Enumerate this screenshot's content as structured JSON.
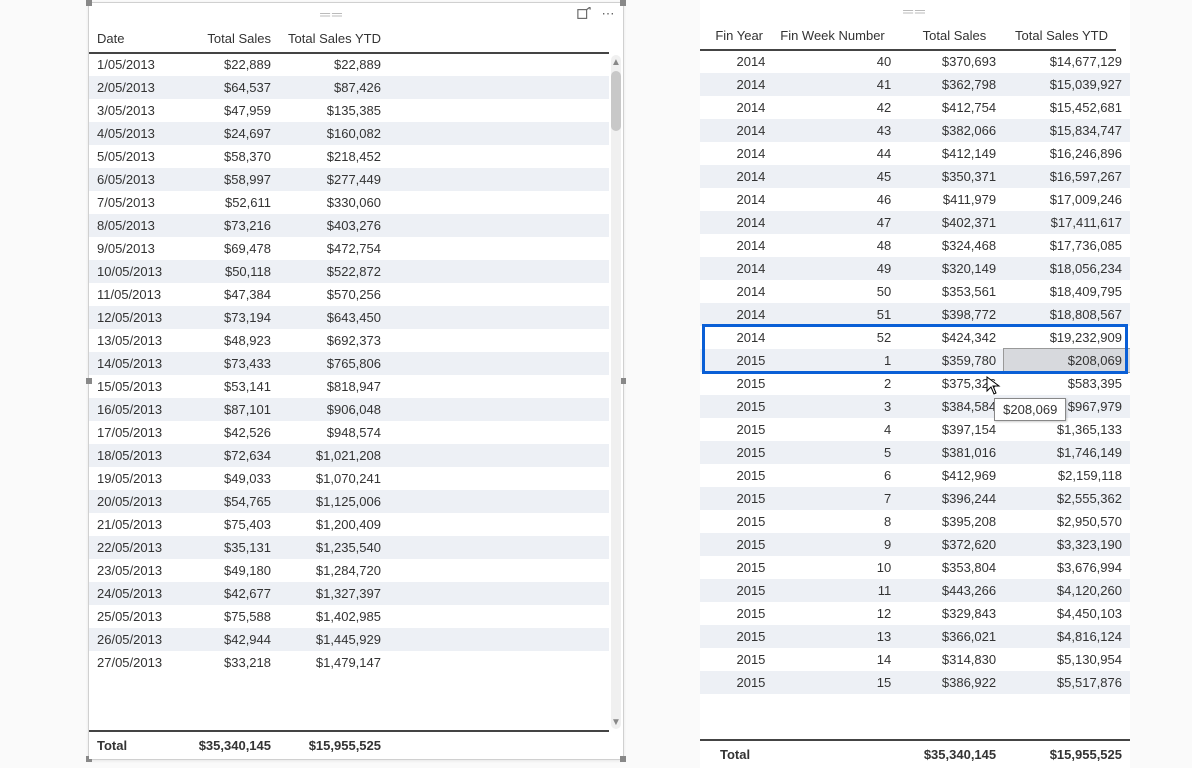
{
  "left_table": {
    "headers": [
      "Date",
      "Total Sales",
      "Total Sales YTD"
    ],
    "rows": [
      {
        "date": "1/05/2013",
        "sales": "$22,889",
        "ytd": "$22,889"
      },
      {
        "date": "2/05/2013",
        "sales": "$64,537",
        "ytd": "$87,426"
      },
      {
        "date": "3/05/2013",
        "sales": "$47,959",
        "ytd": "$135,385"
      },
      {
        "date": "4/05/2013",
        "sales": "$24,697",
        "ytd": "$160,082"
      },
      {
        "date": "5/05/2013",
        "sales": "$58,370",
        "ytd": "$218,452"
      },
      {
        "date": "6/05/2013",
        "sales": "$58,997",
        "ytd": "$277,449"
      },
      {
        "date": "7/05/2013",
        "sales": "$52,611",
        "ytd": "$330,060"
      },
      {
        "date": "8/05/2013",
        "sales": "$73,216",
        "ytd": "$403,276"
      },
      {
        "date": "9/05/2013",
        "sales": "$69,478",
        "ytd": "$472,754"
      },
      {
        "date": "10/05/2013",
        "sales": "$50,118",
        "ytd": "$522,872"
      },
      {
        "date": "11/05/2013",
        "sales": "$47,384",
        "ytd": "$570,256"
      },
      {
        "date": "12/05/2013",
        "sales": "$73,194",
        "ytd": "$643,450"
      },
      {
        "date": "13/05/2013",
        "sales": "$48,923",
        "ytd": "$692,373"
      },
      {
        "date": "14/05/2013",
        "sales": "$73,433",
        "ytd": "$765,806"
      },
      {
        "date": "15/05/2013",
        "sales": "$53,141",
        "ytd": "$818,947"
      },
      {
        "date": "16/05/2013",
        "sales": "$87,101",
        "ytd": "$906,048"
      },
      {
        "date": "17/05/2013",
        "sales": "$42,526",
        "ytd": "$948,574"
      },
      {
        "date": "18/05/2013",
        "sales": "$72,634",
        "ytd": "$1,021,208"
      },
      {
        "date": "19/05/2013",
        "sales": "$49,033",
        "ytd": "$1,070,241"
      },
      {
        "date": "20/05/2013",
        "sales": "$54,765",
        "ytd": "$1,125,006"
      },
      {
        "date": "21/05/2013",
        "sales": "$75,403",
        "ytd": "$1,200,409"
      },
      {
        "date": "22/05/2013",
        "sales": "$35,131",
        "ytd": "$1,235,540"
      },
      {
        "date": "23/05/2013",
        "sales": "$49,180",
        "ytd": "$1,284,720"
      },
      {
        "date": "24/05/2013",
        "sales": "$42,677",
        "ytd": "$1,327,397"
      },
      {
        "date": "25/05/2013",
        "sales": "$75,588",
        "ytd": "$1,402,985"
      },
      {
        "date": "26/05/2013",
        "sales": "$42,944",
        "ytd": "$1,445,929"
      },
      {
        "date": "27/05/2013",
        "sales": "$33,218",
        "ytd": "$1,479,147"
      }
    ],
    "total_label": "Total",
    "total_sales": "$35,340,145",
    "total_ytd": "$15,955,525"
  },
  "right_table": {
    "headers": [
      "Fin Year",
      "Fin Week Number",
      "Total Sales",
      "Total Sales YTD"
    ],
    "rows": [
      {
        "year": "2014",
        "week": "40",
        "sales": "$370,693",
        "ytd": "$14,677,129"
      },
      {
        "year": "2014",
        "week": "41",
        "sales": "$362,798",
        "ytd": "$15,039,927"
      },
      {
        "year": "2014",
        "week": "42",
        "sales": "$412,754",
        "ytd": "$15,452,681"
      },
      {
        "year": "2014",
        "week": "43",
        "sales": "$382,066",
        "ytd": "$15,834,747"
      },
      {
        "year": "2014",
        "week": "44",
        "sales": "$412,149",
        "ytd": "$16,246,896"
      },
      {
        "year": "2014",
        "week": "45",
        "sales": "$350,371",
        "ytd": "$16,597,267"
      },
      {
        "year": "2014",
        "week": "46",
        "sales": "$411,979",
        "ytd": "$17,009,246"
      },
      {
        "year": "2014",
        "week": "47",
        "sales": "$402,371",
        "ytd": "$17,411,617"
      },
      {
        "year": "2014",
        "week": "48",
        "sales": "$324,468",
        "ytd": "$17,736,085"
      },
      {
        "year": "2014",
        "week": "49",
        "sales": "$320,149",
        "ytd": "$18,056,234"
      },
      {
        "year": "2014",
        "week": "50",
        "sales": "$353,561",
        "ytd": "$18,409,795"
      },
      {
        "year": "2014",
        "week": "51",
        "sales": "$398,772",
        "ytd": "$18,808,567"
      },
      {
        "year": "2014",
        "week": "52",
        "sales": "$424,342",
        "ytd": "$19,232,909"
      },
      {
        "year": "2015",
        "week": "1",
        "sales": "$359,780",
        "ytd": "$208,069"
      },
      {
        "year": "2015",
        "week": "2",
        "sales": "$375,326",
        "ytd": "$583,395"
      },
      {
        "year": "2015",
        "week": "3",
        "sales": "$384,584",
        "ytd": "$967,979"
      },
      {
        "year": "2015",
        "week": "4",
        "sales": "$397,154",
        "ytd": "$1,365,133"
      },
      {
        "year": "2015",
        "week": "5",
        "sales": "$381,016",
        "ytd": "$1,746,149"
      },
      {
        "year": "2015",
        "week": "6",
        "sales": "$412,969",
        "ytd": "$2,159,118"
      },
      {
        "year": "2015",
        "week": "7",
        "sales": "$396,244",
        "ytd": "$2,555,362"
      },
      {
        "year": "2015",
        "week": "8",
        "sales": "$395,208",
        "ytd": "$2,950,570"
      },
      {
        "year": "2015",
        "week": "9",
        "sales": "$372,620",
        "ytd": "$3,323,190"
      },
      {
        "year": "2015",
        "week": "10",
        "sales": "$353,804",
        "ytd": "$3,676,994"
      },
      {
        "year": "2015",
        "week": "11",
        "sales": "$443,266",
        "ytd": "$4,120,260"
      },
      {
        "year": "2015",
        "week": "12",
        "sales": "$329,843",
        "ytd": "$4,450,103"
      },
      {
        "year": "2015",
        "week": "13",
        "sales": "$366,021",
        "ytd": "$4,816,124"
      },
      {
        "year": "2015",
        "week": "14",
        "sales": "$314,830",
        "ytd": "$5,130,954"
      },
      {
        "year": "2015",
        "week": "15",
        "sales": "$386,922",
        "ytd": "$5,517,876"
      }
    ],
    "total_label": "Total",
    "total_sales": "$35,340,145",
    "total_ytd": "$15,955,525"
  },
  "tooltip_value": "$208,069",
  "highlight_rows": [
    12,
    13
  ],
  "selected_cell": {
    "row": 13,
    "col": "ytd"
  }
}
